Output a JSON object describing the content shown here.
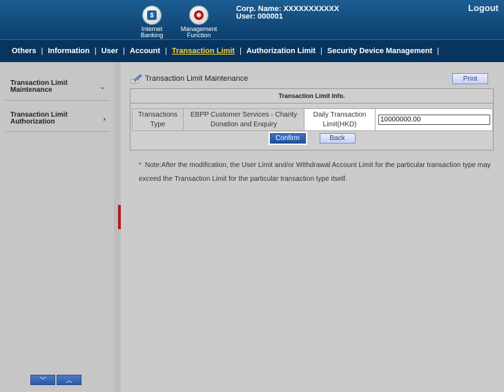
{
  "header": {
    "icons": [
      {
        "label_line1": "Internet",
        "label_line2": "Banking",
        "icon": "monitor-dollar-icon",
        "glyph": "$"
      },
      {
        "label_line1": "Management",
        "label_line2": "Function",
        "icon": "gears-icon",
        "glyph": "✱"
      }
    ],
    "corp_name": "Corp. Name: XXXXXXXXXXX",
    "user": "User: 000001",
    "logout": "Logout"
  },
  "nav": {
    "items": [
      "Others",
      "Information",
      "User",
      "Account",
      "Transaction Limit",
      "Authorization Limit",
      "Security Device Management"
    ],
    "active": "Transaction Limit",
    "separator": "|"
  },
  "sidebar": {
    "items": [
      {
        "label": "Transaction Limit Maintenance",
        "chevron": "⌄"
      },
      {
        "label": "Transaction Limit Authorization",
        "chevron": "›"
      }
    ],
    "scroll_down": "﹀",
    "scroll_up": "︿"
  },
  "collapse_glyph": "‹",
  "main": {
    "title": "Transaction Limit Maintenance",
    "print_label": "Print",
    "panel_title": "Transaction Limit Info.",
    "transactions_type_label": "Transactions Type",
    "transactions_type_value": "EBPP Customer Services - Charity Donation and Enquiry",
    "daily_limit_label": "Daily Transaction Limit(HKD)",
    "daily_limit_value": "10000000.00",
    "confirm_label": "Confirm",
    "back_label": "Back",
    "note_star": "*",
    "note": "Note:After the modification, the User Limit and/or Withdrawal Account Limit for the particular transaction type may exceed the Transaction Limit for the particular transaction type itself."
  },
  "colors": {
    "header_bg": "#0c3f6d",
    "nav_bg": "#07355f",
    "active_nav": "#f6d43a",
    "accent_red": "#b3191a",
    "confirm_bg": "#214e9e"
  }
}
